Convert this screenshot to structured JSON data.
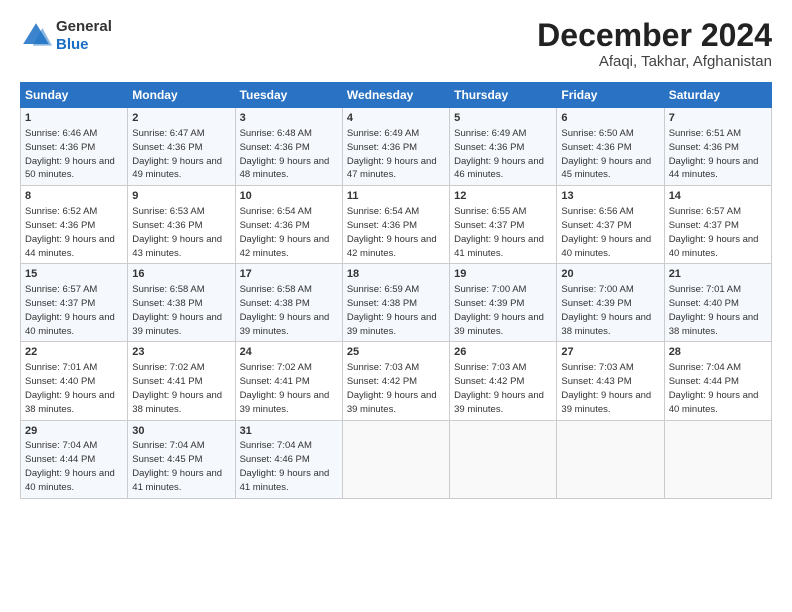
{
  "header": {
    "logo": {
      "general": "General",
      "blue": "Blue"
    },
    "title": "December 2024",
    "subtitle": "Afaqi, Takhar, Afghanistan"
  },
  "days_of_week": [
    "Sunday",
    "Monday",
    "Tuesday",
    "Wednesday",
    "Thursday",
    "Friday",
    "Saturday"
  ],
  "weeks": [
    [
      {
        "day": "1",
        "sunrise": "6:46 AM",
        "sunset": "4:36 PM",
        "daylight": "9 hours and 50 minutes."
      },
      {
        "day": "2",
        "sunrise": "6:47 AM",
        "sunset": "4:36 PM",
        "daylight": "9 hours and 49 minutes."
      },
      {
        "day": "3",
        "sunrise": "6:48 AM",
        "sunset": "4:36 PM",
        "daylight": "9 hours and 48 minutes."
      },
      {
        "day": "4",
        "sunrise": "6:49 AM",
        "sunset": "4:36 PM",
        "daylight": "9 hours and 47 minutes."
      },
      {
        "day": "5",
        "sunrise": "6:49 AM",
        "sunset": "4:36 PM",
        "daylight": "9 hours and 46 minutes."
      },
      {
        "day": "6",
        "sunrise": "6:50 AM",
        "sunset": "4:36 PM",
        "daylight": "9 hours and 45 minutes."
      },
      {
        "day": "7",
        "sunrise": "6:51 AM",
        "sunset": "4:36 PM",
        "daylight": "9 hours and 44 minutes."
      }
    ],
    [
      {
        "day": "8",
        "sunrise": "6:52 AM",
        "sunset": "4:36 PM",
        "daylight": "9 hours and 44 minutes."
      },
      {
        "day": "9",
        "sunrise": "6:53 AM",
        "sunset": "4:36 PM",
        "daylight": "9 hours and 43 minutes."
      },
      {
        "day": "10",
        "sunrise": "6:54 AM",
        "sunset": "4:36 PM",
        "daylight": "9 hours and 42 minutes."
      },
      {
        "day": "11",
        "sunrise": "6:54 AM",
        "sunset": "4:36 PM",
        "daylight": "9 hours and 42 minutes."
      },
      {
        "day": "12",
        "sunrise": "6:55 AM",
        "sunset": "4:37 PM",
        "daylight": "9 hours and 41 minutes."
      },
      {
        "day": "13",
        "sunrise": "6:56 AM",
        "sunset": "4:37 PM",
        "daylight": "9 hours and 40 minutes."
      },
      {
        "day": "14",
        "sunrise": "6:57 AM",
        "sunset": "4:37 PM",
        "daylight": "9 hours and 40 minutes."
      }
    ],
    [
      {
        "day": "15",
        "sunrise": "6:57 AM",
        "sunset": "4:37 PM",
        "daylight": "9 hours and 40 minutes."
      },
      {
        "day": "16",
        "sunrise": "6:58 AM",
        "sunset": "4:38 PM",
        "daylight": "9 hours and 39 minutes."
      },
      {
        "day": "17",
        "sunrise": "6:58 AM",
        "sunset": "4:38 PM",
        "daylight": "9 hours and 39 minutes."
      },
      {
        "day": "18",
        "sunrise": "6:59 AM",
        "sunset": "4:38 PM",
        "daylight": "9 hours and 39 minutes."
      },
      {
        "day": "19",
        "sunrise": "7:00 AM",
        "sunset": "4:39 PM",
        "daylight": "9 hours and 39 minutes."
      },
      {
        "day": "20",
        "sunrise": "7:00 AM",
        "sunset": "4:39 PM",
        "daylight": "9 hours and 38 minutes."
      },
      {
        "day": "21",
        "sunrise": "7:01 AM",
        "sunset": "4:40 PM",
        "daylight": "9 hours and 38 minutes."
      }
    ],
    [
      {
        "day": "22",
        "sunrise": "7:01 AM",
        "sunset": "4:40 PM",
        "daylight": "9 hours and 38 minutes."
      },
      {
        "day": "23",
        "sunrise": "7:02 AM",
        "sunset": "4:41 PM",
        "daylight": "9 hours and 38 minutes."
      },
      {
        "day": "24",
        "sunrise": "7:02 AM",
        "sunset": "4:41 PM",
        "daylight": "9 hours and 39 minutes."
      },
      {
        "day": "25",
        "sunrise": "7:03 AM",
        "sunset": "4:42 PM",
        "daylight": "9 hours and 39 minutes."
      },
      {
        "day": "26",
        "sunrise": "7:03 AM",
        "sunset": "4:42 PM",
        "daylight": "9 hours and 39 minutes."
      },
      {
        "day": "27",
        "sunrise": "7:03 AM",
        "sunset": "4:43 PM",
        "daylight": "9 hours and 39 minutes."
      },
      {
        "day": "28",
        "sunrise": "7:04 AM",
        "sunset": "4:44 PM",
        "daylight": "9 hours and 40 minutes."
      }
    ],
    [
      {
        "day": "29",
        "sunrise": "7:04 AM",
        "sunset": "4:44 PM",
        "daylight": "9 hours and 40 minutes."
      },
      {
        "day": "30",
        "sunrise": "7:04 AM",
        "sunset": "4:45 PM",
        "daylight": "9 hours and 41 minutes."
      },
      {
        "day": "31",
        "sunrise": "7:04 AM",
        "sunset": "4:46 PM",
        "daylight": "9 hours and 41 minutes."
      },
      null,
      null,
      null,
      null
    ]
  ],
  "labels": {
    "sunrise": "Sunrise:",
    "sunset": "Sunset:",
    "daylight": "Daylight:"
  }
}
